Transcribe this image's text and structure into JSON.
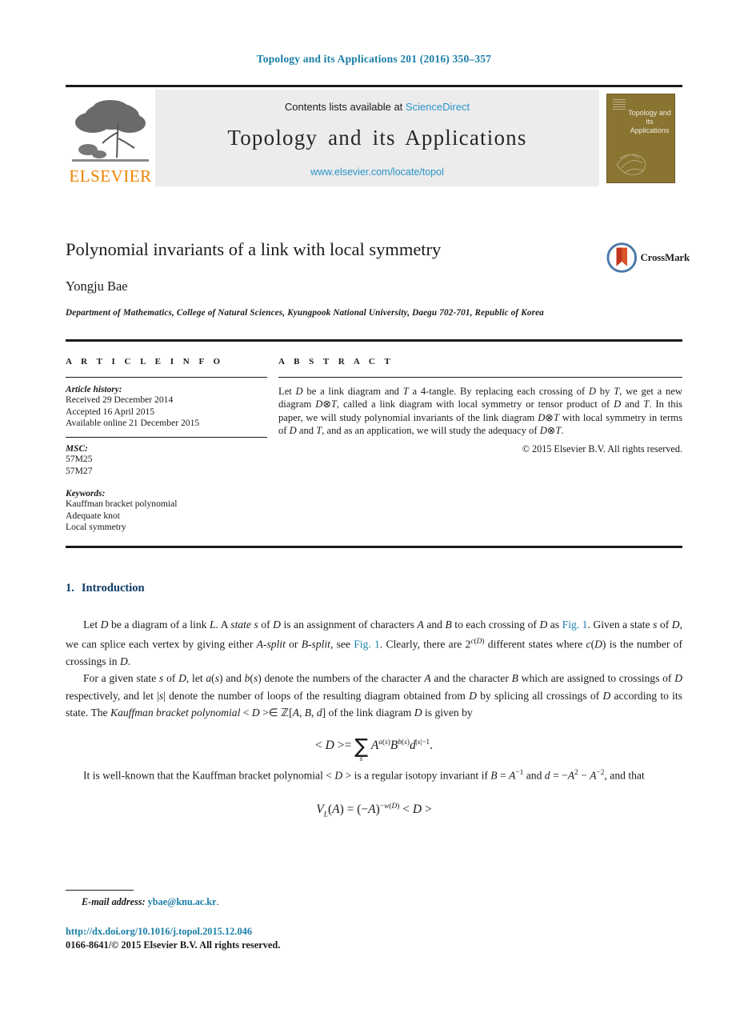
{
  "running_head": "Topology and its Applications 201 (2016) 350–357",
  "masthead": {
    "contents_prefix": "Contents lists available at ",
    "sciencedirect": "ScienceDirect",
    "journal_name": "Topology and its Applications",
    "journal_url": "www.elsevier.com/locate/topol",
    "publisher_word": "ELSEVIER",
    "cover_title": "Topology and its Applications",
    "accent_orange": "#ef8200",
    "link_blue": "#2a93c9",
    "cover_bg": "#8a7431"
  },
  "article": {
    "title": "Polynomial invariants of a link with local symmetry",
    "author": "Yongju Bae",
    "affiliation": "Department of Mathematics, College of Natural Sciences, Kyungpook National University, Daegu 702-701, Republic of Korea",
    "crossmark_label": "CrossMark"
  },
  "info": {
    "heading": "A R T I C L E   I N F O",
    "history_label": "Article history:",
    "history": [
      "Received 29 December 2014",
      "Accepted 16 April 2015",
      "Available online 21 December 2015"
    ],
    "msc_label": "MSC:",
    "msc": [
      "57M25",
      "57M27"
    ],
    "keywords_label": "Keywords:",
    "keywords": [
      "Kauffman bracket polynomial",
      "Adequate knot",
      "Local symmetry"
    ]
  },
  "abstract": {
    "heading": "A B S T R A C T",
    "copyright": "© 2015 Elsevier B.V. All rights reserved."
  },
  "body": {
    "section_number": "1.",
    "section_title": "Introduction"
  },
  "footer": {
    "email_label": "E-mail address:",
    "email": "ybae@knu.ac.kr",
    "email_period": ".",
    "doi": "http://dx.doi.org/10.1016/j.topol.2015.12.046",
    "issn": "0166-8641/© 2015 Elsevier B.V. All rights reserved."
  }
}
